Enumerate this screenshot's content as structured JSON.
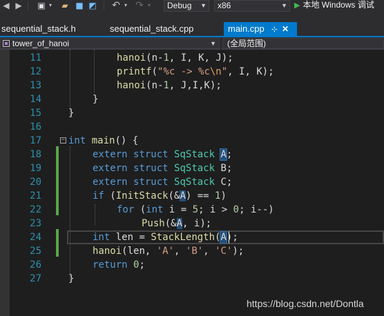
{
  "toolbar": {
    "icons": [
      "back-icon",
      "forward-icon",
      "new-item-icon",
      "open-folder-icon",
      "save-icon",
      "save-all-icon",
      "undo-icon",
      "redo-icon"
    ],
    "config": "Debug",
    "platform": "x86",
    "run_label": "本地 Windows 调试"
  },
  "tabs": [
    {
      "label": "sequential_stack.h",
      "active": false
    },
    {
      "label": "sequential_stack.cpp",
      "active": false
    },
    {
      "label": "main.cpp",
      "active": true,
      "pin": "⊹",
      "close": "✕"
    }
  ],
  "navbar": {
    "scope": "tower_of_hanoi",
    "member": "(全局范围)"
  },
  "editor": {
    "lines": [
      {
        "no": "11",
        "code": "hanoi(n-1, I, K, J);"
      },
      {
        "no": "12",
        "code": "printf(\"%c -> %c\\n\", I, K);"
      },
      {
        "no": "13",
        "code": "hanoi(n-1, J,I,K);"
      },
      {
        "no": "14",
        "code": "}"
      },
      {
        "no": "15",
        "code": "}"
      },
      {
        "no": "16",
        "code": ""
      },
      {
        "no": "17",
        "code": "int main() {"
      },
      {
        "no": "18",
        "code": "extern struct SqStack A;"
      },
      {
        "no": "19",
        "code": "extern struct SqStack B;"
      },
      {
        "no": "20",
        "code": "extern struct SqStack C;"
      },
      {
        "no": "21",
        "code": "if (InitStack(&A) == 1)"
      },
      {
        "no": "22",
        "code": "for (int i = 5; i > 0; i--)"
      },
      {
        "no": "23",
        "code": "Push(&A, i);"
      },
      {
        "no": "24",
        "code": "int len = StackLength(A);"
      },
      {
        "no": "25",
        "code": "hanoi(len, 'A', 'B', 'C');"
      },
      {
        "no": "26",
        "code": "return 0;"
      },
      {
        "no": "27",
        "code": "}"
      }
    ],
    "tokens": {
      "hanoi": "hanoi",
      "printf": "printf",
      "n": "n",
      "I": "I",
      "J": "J",
      "K": "K",
      "one": "1",
      "fmt_a": "\"%c -> %c",
      "fmt_esc": "\\n",
      "fmt_b": "\"",
      "int": "int",
      "main": "main",
      "extern": "extern",
      "struct": "struct",
      "SqStack": "SqStack",
      "A": "A",
      "B": "B",
      "C": "C",
      "if": "if",
      "InitStack": "InitStack",
      "for": "for",
      "i": "i",
      "five": "5",
      "zero": "0",
      "Push": "Push",
      "len": "len",
      "StackLength": "StackLength",
      "chA": "'A'",
      "chB": "'B'",
      "chC": "'C'",
      "return": "return"
    }
  },
  "watermark": "https://blog.csdn.net/Dontla",
  "colors": {
    "background": "#1e1e1e",
    "chrome": "#2d2d30",
    "accent": "#007acc",
    "keyword": "#569cd6",
    "type": "#4ec9b0",
    "string": "#d69d85",
    "number": "#b5cea8",
    "function": "#dcdcaa",
    "line_number": "#2b91af",
    "change_bar": "#57a64a",
    "highlight": "#264f78"
  }
}
